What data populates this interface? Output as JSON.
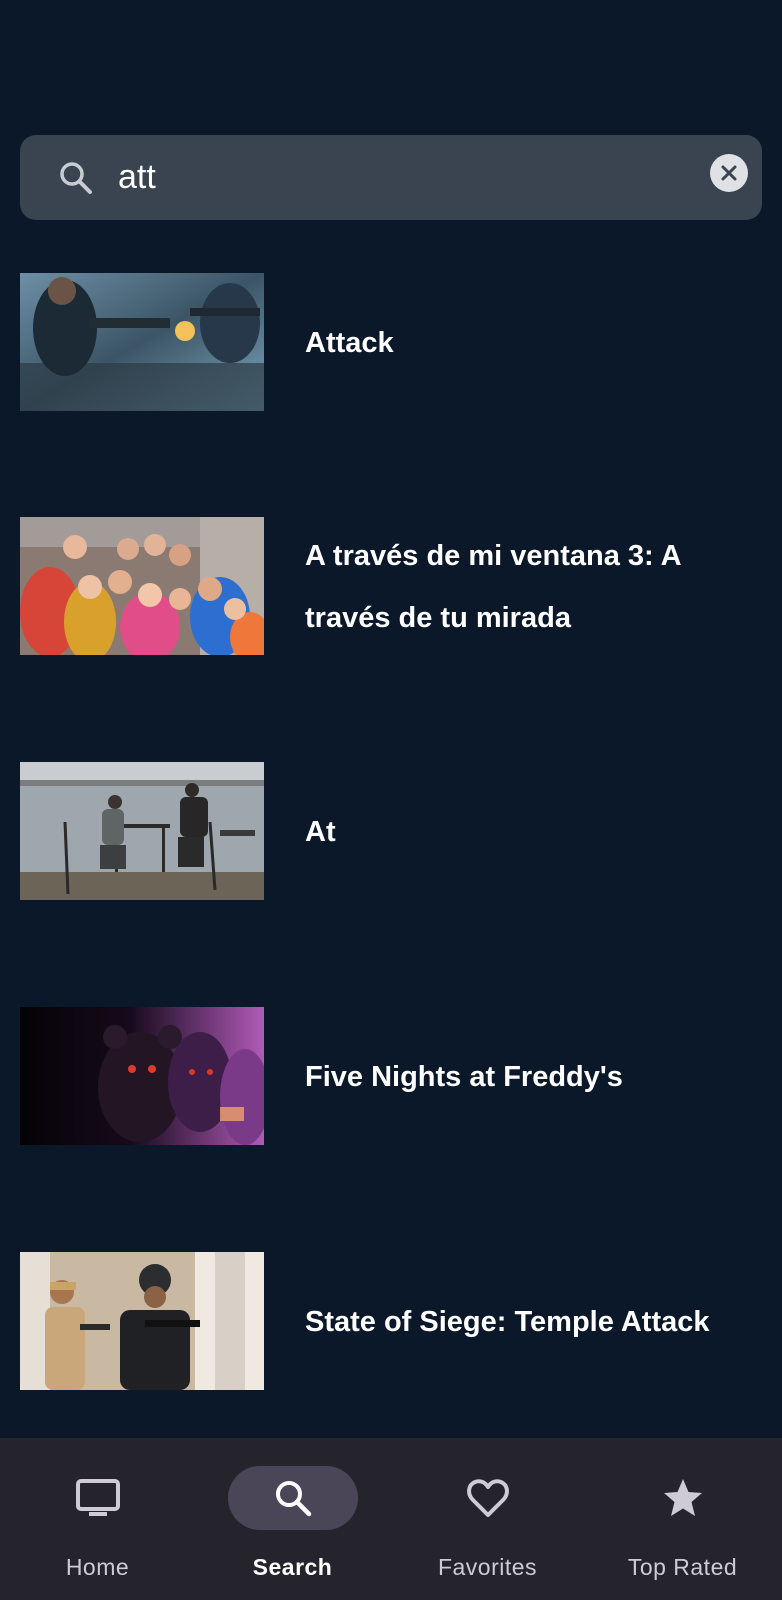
{
  "search": {
    "query": "att",
    "icon": "search-icon",
    "clear_icon": "close-icon"
  },
  "results": [
    {
      "title": "Attack"
    },
    {
      "title": "A través de mi ventana 3: A través de tu mirada"
    },
    {
      "title": "At"
    },
    {
      "title": "Five Nights at Freddy's"
    },
    {
      "title": "State of Siege: Temple Attack"
    }
  ],
  "bottom_nav": {
    "items": [
      {
        "label": "Home",
        "icon": "tv-icon",
        "active": false
      },
      {
        "label": "Search",
        "icon": "search-icon",
        "active": true
      },
      {
        "label": "Favorites",
        "icon": "heart-icon",
        "active": false
      },
      {
        "label": "Top Rated",
        "icon": "star-icon",
        "active": false
      }
    ]
  },
  "colors": {
    "background": "#0b1829",
    "search_bar": "#3a4350",
    "nav_background": "#25242c",
    "nav_active_pill": "#4a4658"
  }
}
